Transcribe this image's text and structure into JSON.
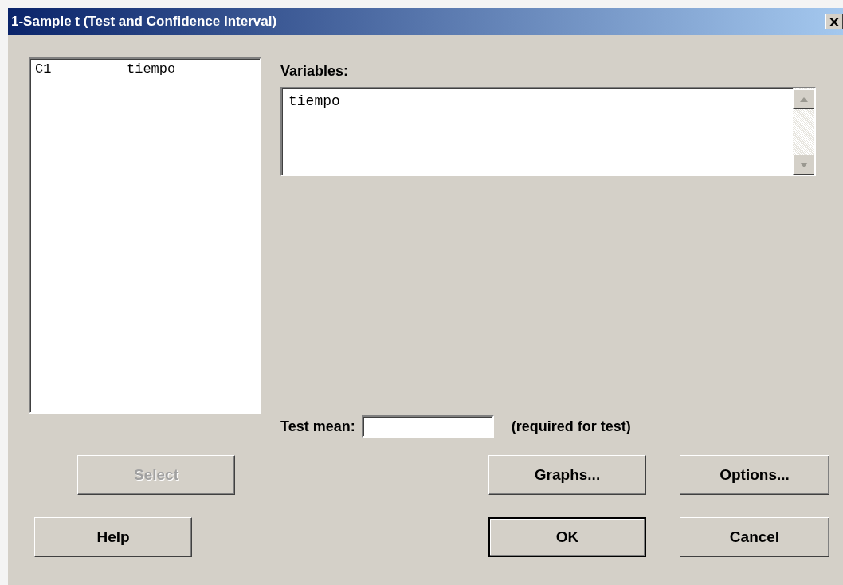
{
  "window": {
    "title": "1-Sample t (Test and Confidence Interval)"
  },
  "column_list": {
    "items": [
      {
        "column": "C1",
        "name": "tiempo",
        "selected": false
      }
    ]
  },
  "variables": {
    "label": "Variables:",
    "value": "tiempo"
  },
  "test_mean": {
    "label": "Test mean:",
    "note": "(required for test)"
  },
  "button_rows": [
    [
      {
        "label": "Select",
        "disabled": true,
        "default": false
      },
      {
        "label": "Graphs...",
        "disabled": false,
        "default": false
      },
      {
        "label": "Options...",
        "disabled": false,
        "default": false
      }
    ],
    [
      {
        "label": "Help",
        "disabled": false,
        "default": false
      },
      {
        "label": "OK",
        "disabled": false,
        "default": true
      },
      {
        "label": "Cancel",
        "disabled": false,
        "default": false
      }
    ]
  ]
}
